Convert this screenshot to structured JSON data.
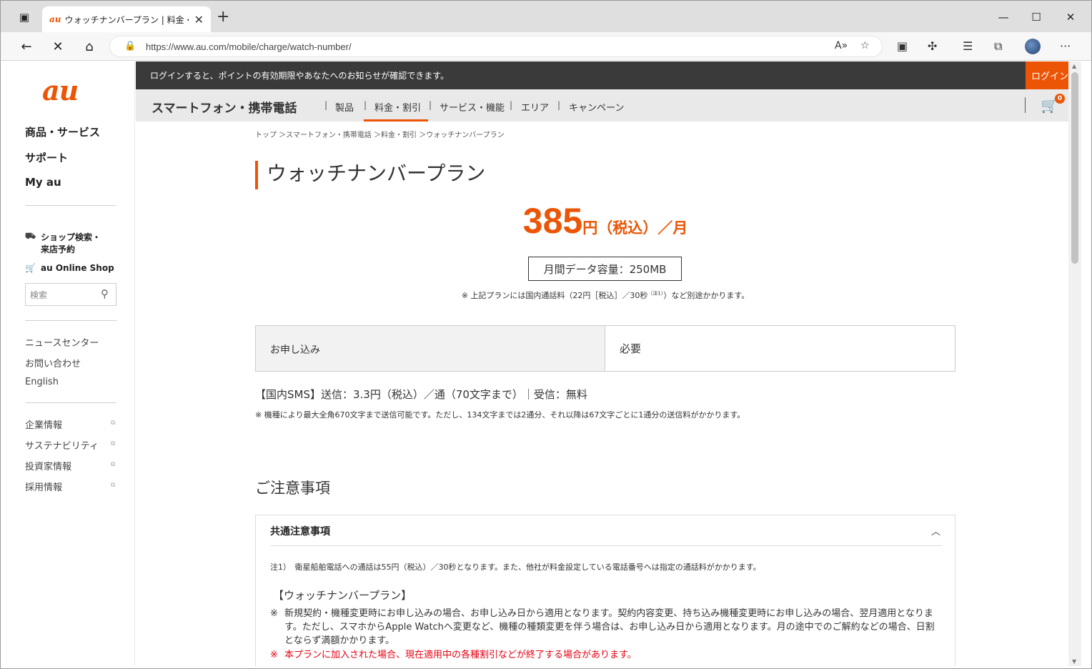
{
  "browser": {
    "tab_title": "ウォッチナンバープラン | 料金・割引：",
    "tab_favicon": "au",
    "url": "https://www.au.com/mobile/charge/watch-number/"
  },
  "sidebar": {
    "logo": "au",
    "main": [
      "商品・サービス",
      "サポート",
      "My au"
    ],
    "shop_search": "ショップ検索・来店予約",
    "online_shop": "au Online Shop",
    "search_placeholder": "検索",
    "links": [
      "ニュースセンター",
      "お問い合わせ",
      "English"
    ],
    "corp_links": [
      "企業情報",
      "サステナビリティ",
      "投資家情報",
      "採用情報"
    ]
  },
  "loginbar": {
    "message": "ログインすると、ポイントの有効期限やあなたへのお知らせが確認できます。",
    "button": "ログイン"
  },
  "catnav": {
    "title": "スマートフォン・携帯電話",
    "items": [
      "製品",
      "料金・割引",
      "サービス・機能",
      "エリア",
      "キャンペーン"
    ],
    "active_index": 1,
    "cart_count": "0"
  },
  "content": {
    "breadcrumb": "トップ ＞スマートフォン・携帯電話 ＞料金・割引 ＞ウォッチナンバープラン",
    "title": "ウォッチナンバープラン",
    "price_number": "385",
    "price_suffix": "円（税込）／月",
    "data_capacity": "月間データ容量：250MB",
    "data_note": "※ 上記プランには国内通話料（22円［税込］／30秒",
    "data_note_sup": "（注1）",
    "data_note_end": "）など別途かかります。",
    "table_header": "お申し込み",
    "table_value": "必要",
    "sms_line": "【国内SMS】送信：3.3円（税込）／通（70文字まで）｜受信：無料",
    "sms_note": "※ 機種により最大全角670文字まで送信可能です。ただし、134文字までは2通分、それ以降は67文字ごとに1通分の送信料がかかります。",
    "notice_heading": "ご注意事項",
    "accordion_title": "共通注意事項",
    "note1": "注1）　衛星船舶電話への通話は55円（税込）／30秒となります。また、他社が料金設定している電話番号へは指定の通話料がかかります。",
    "subheading": "【ウォッチナンバープラン】",
    "item1_mark": "※",
    "item1": "新規契約・機種変更時にお申し込みの場合、お申し込み日から適用となります。契約内容変更、持ち込み機種変更時にお申し込みの場合、翌月適用となります。ただし、スマホからApple Watchへ変更など、機種の種類変更を伴う場合は、お申し込み日から適用となります。月の途中でのご解約などの場合、日割とならず満額かかります。",
    "item2_mark": "※",
    "item2": "本プランに加入された場合、現在適用中の各種割引などが終了する場合があります。"
  },
  "colors": {
    "accent": "#eb5505",
    "dark_bar": "#3a3a3a",
    "warning": "#e60012"
  }
}
